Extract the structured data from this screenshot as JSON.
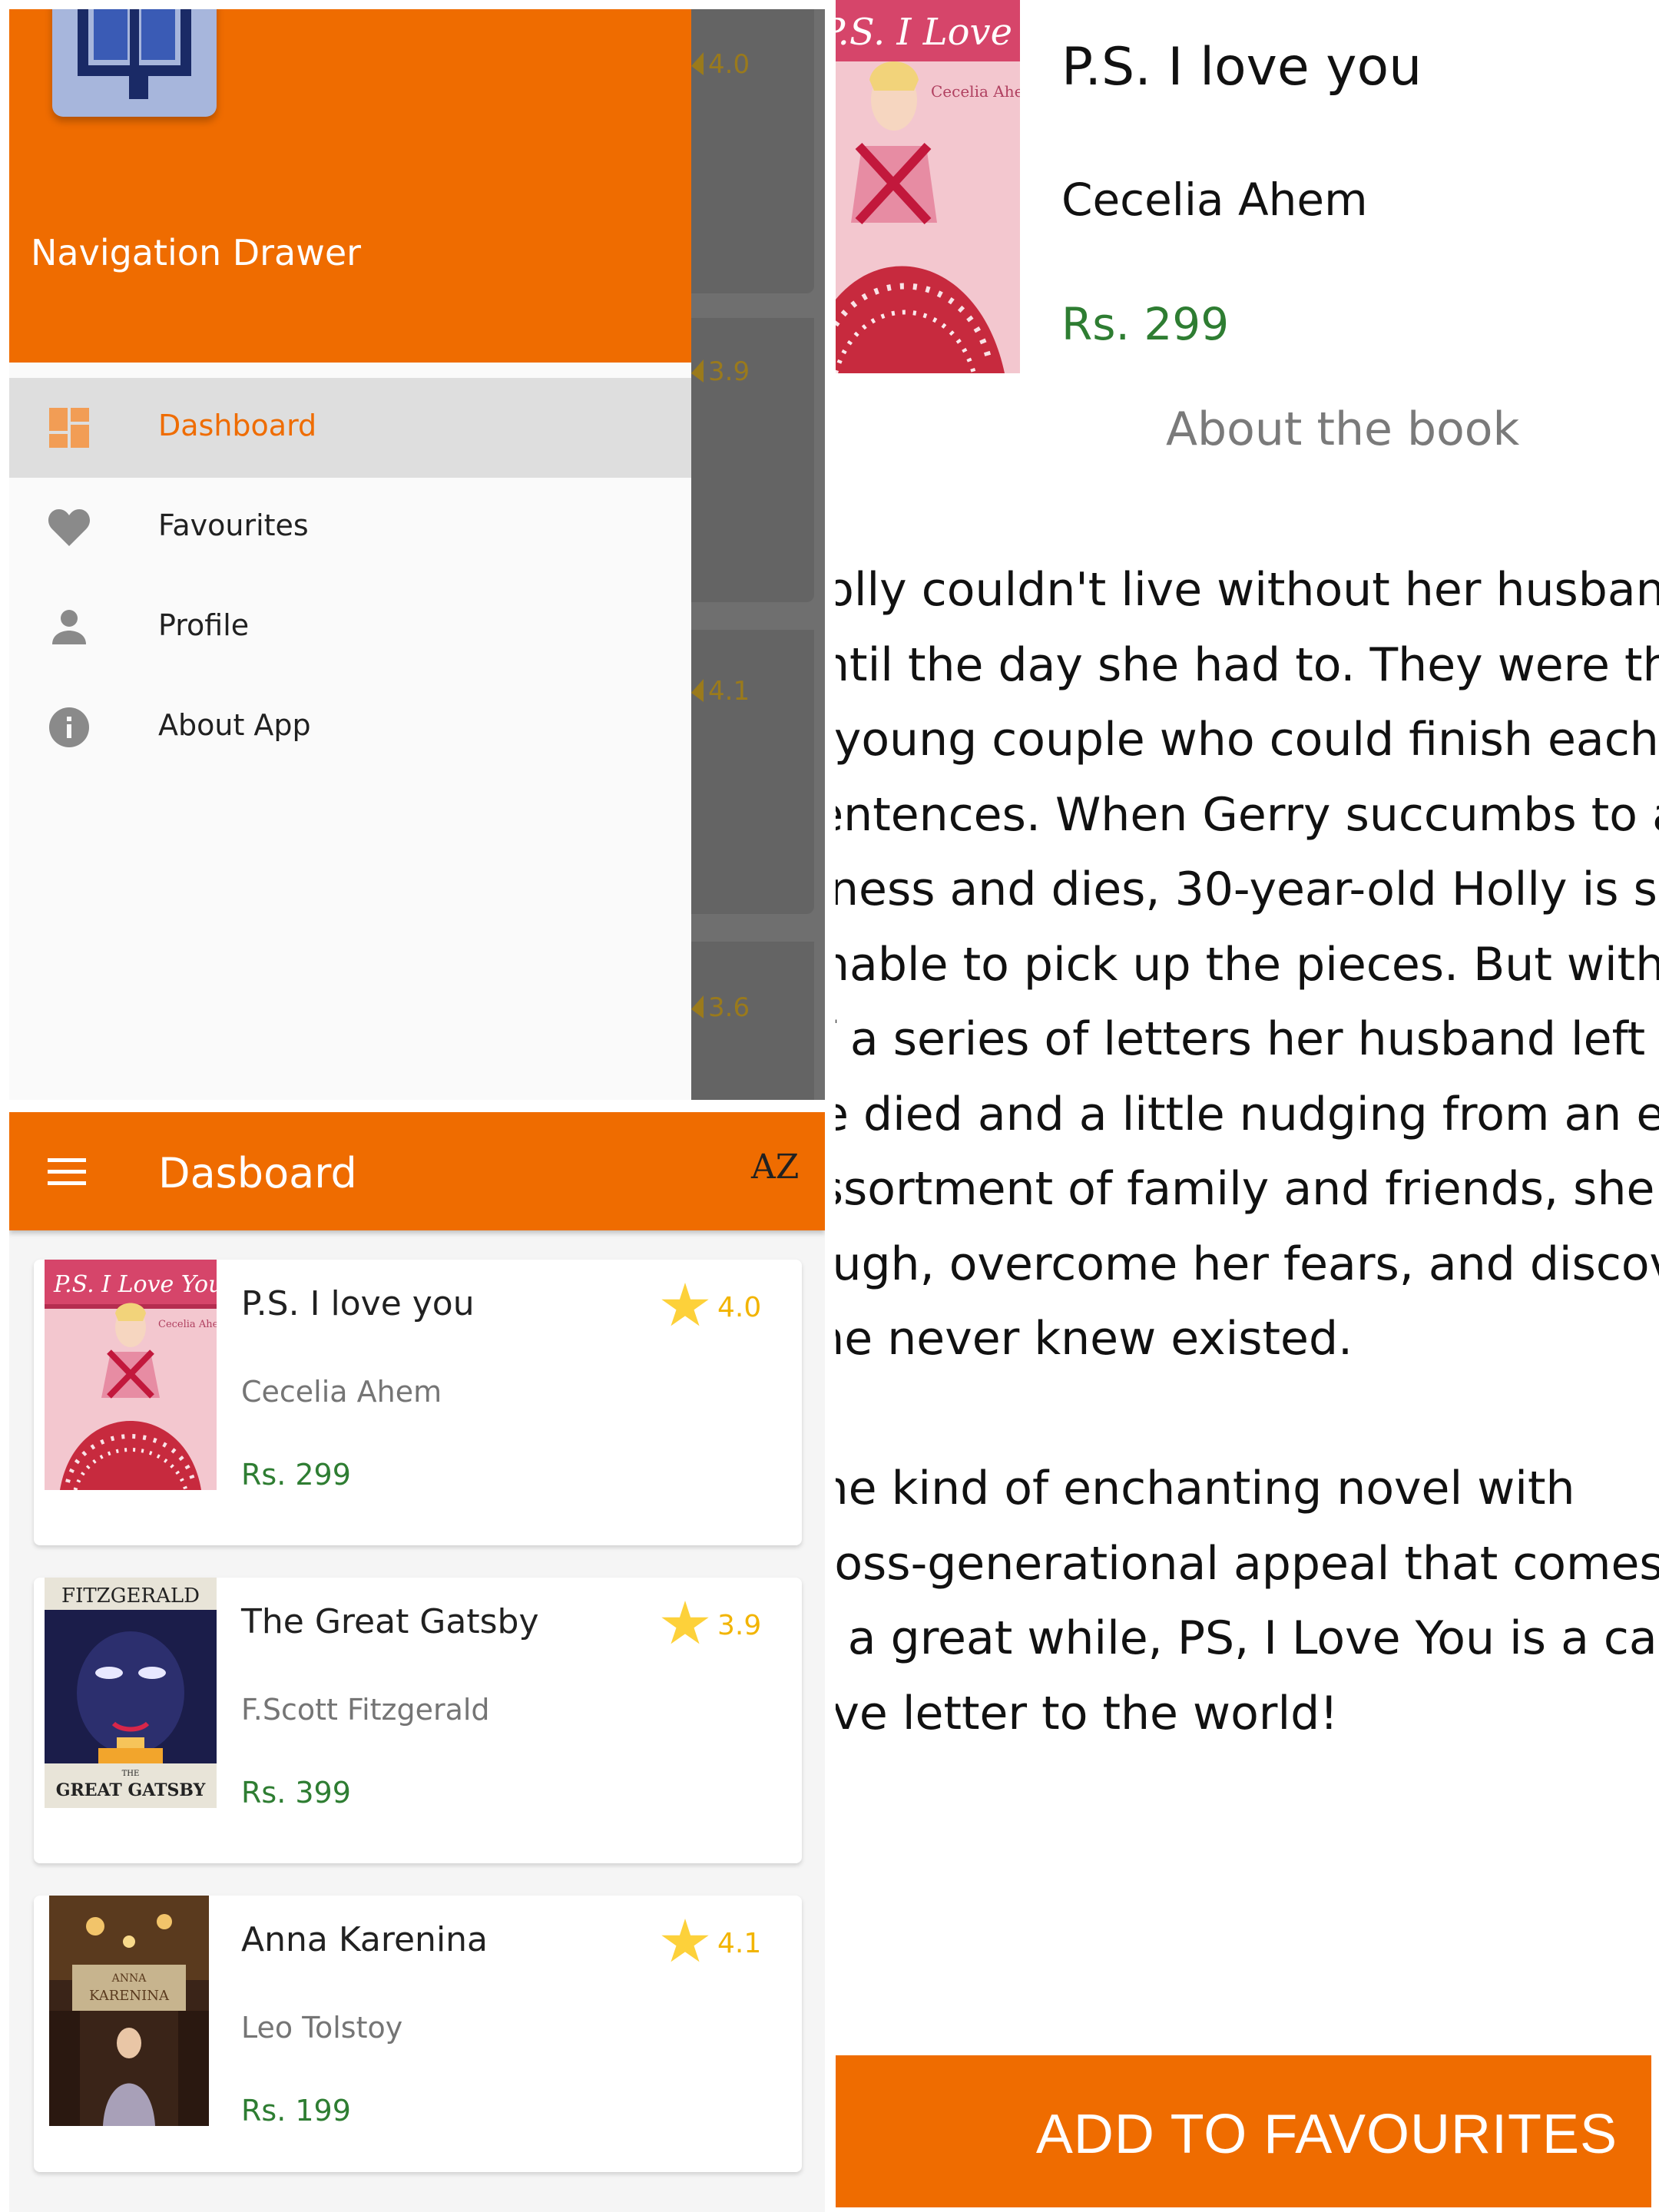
{
  "drawer": {
    "title": "Navigation Drawer",
    "items": [
      {
        "label": "Dashboard",
        "icon": "dashboard-icon",
        "active": true
      },
      {
        "label": "Favourites",
        "icon": "heart-icon",
        "active": false
      },
      {
        "label": "Profile",
        "icon": "person-icon",
        "active": false
      },
      {
        "label": "About App",
        "icon": "info-icon",
        "active": false
      }
    ],
    "background_ratings": [
      "4.0",
      "3.9",
      "4.1",
      "3.6"
    ]
  },
  "dashboard": {
    "toolbar_title": "Dasboard",
    "sort_icon_label": "AZ",
    "books": [
      {
        "title": "P.S. I love you",
        "author": "Cecelia Ahem",
        "price": "Rs. 299",
        "rating": "4.0",
        "cover_title": "P.S. I Love You",
        "cover_author": "Cecelia Ahern"
      },
      {
        "title": "The Great Gatsby",
        "author": "F.Scott Fitzgerald",
        "price": "Rs. 399",
        "rating": "3.9",
        "cover_top": "FITZGERALD",
        "cover_bottom": "GREAT GATSBY",
        "cover_small": "THE"
      },
      {
        "title": "Anna Karenina",
        "author": "Leo Tolstoy",
        "price": "Rs. 199",
        "rating": "4.1",
        "cover_line1": "ANNA",
        "cover_line2": "KARENINA"
      }
    ]
  },
  "detail": {
    "title": "P.S. I love you",
    "author": "Cecelia Ahem",
    "price": "Rs. 299",
    "about_heading": "About the book",
    "description": "Holly couldn't live without her husband\nuntil the day she had to. They were the\na young couple who could finish each\nsentences. When Gerry succumbs to a t\nillness and dies, 30-year-old Holly is set\nunable to pick up the pieces. But with t\nof a series of letters her husband left h\nhe died and a little nudging from an ec\nassortment of family and friends, she le\nlaugh, overcome her fears, and discove\nshe never knew existed.\n\nThe kind of enchanting novel with\ncross-generational appeal that comes a\nin a great while, PS, I Love You is a cap\nlove letter to the world!",
    "button_label": "ADD TO FAVOURITES"
  },
  "colors": {
    "accent": "#ef6c00",
    "price_green": "#2e7d32",
    "star_yellow": "#fdd13a",
    "rating_text": "#f2b400"
  }
}
